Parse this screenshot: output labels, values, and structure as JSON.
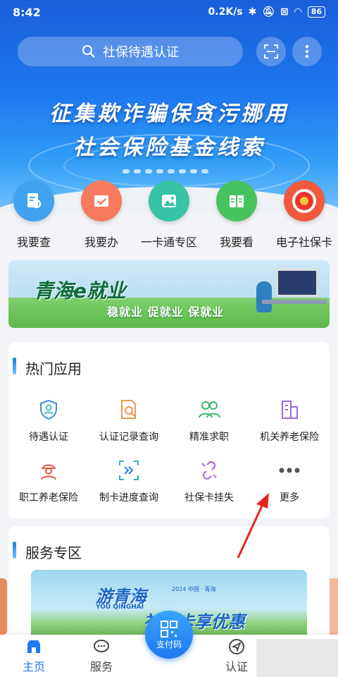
{
  "status": {
    "time": "8:42",
    "net_speed": "0.2K/s",
    "battery": "86"
  },
  "search": {
    "placeholder": "社保待遇认证"
  },
  "hero": {
    "line1": "征集欺诈骗保贪污挪用",
    "line2": "社会保险基金线索"
  },
  "quick": [
    {
      "label": "我要查",
      "icon": "search-doc-icon",
      "color": "#3fa3f0"
    },
    {
      "label": "我要办",
      "icon": "calendar-check-icon",
      "color": "#f77a5c"
    },
    {
      "label": "一卡通专区",
      "icon": "image-card-icon",
      "color": "#36c3a6"
    },
    {
      "label": "我要看",
      "icon": "book-icon",
      "color": "#48c25e"
    },
    {
      "label": "电子社保卡",
      "icon": "emblem-icon",
      "color": "#f05a3a"
    }
  ],
  "banner2": {
    "title": "青海e就业",
    "subtitle": "稳就业 促就业 保就业"
  },
  "hot": {
    "title": "热门应用",
    "apps": [
      {
        "label": "待遇认证",
        "icon": "shield-person-icon"
      },
      {
        "label": "认证记录查询",
        "icon": "doc-search-icon"
      },
      {
        "label": "精准求职",
        "icon": "people-icon"
      },
      {
        "label": "机关养老保险",
        "icon": "building-icon"
      },
      {
        "label": "职工养老保险",
        "icon": "worker-icon"
      },
      {
        "label": "制卡进度查询",
        "icon": "scan-progress-icon"
      },
      {
        "label": "社保卡挂失",
        "icon": "broken-link-icon"
      },
      {
        "label": "更多",
        "icon": "more-dots-icon"
      }
    ]
  },
  "service": {
    "title": "服务专区",
    "banner_title": "游青海",
    "banner_en": "YOU QINGHAI",
    "banner_mini": "2024 中国 · 青海",
    "banner_sub": "社保卡享优惠"
  },
  "tabs": [
    {
      "label": "主页",
      "icon": "home-icon"
    },
    {
      "label": "服务",
      "icon": "chat-icon"
    },
    {
      "label": "认证",
      "icon": "navigate-icon"
    }
  ],
  "pay": {
    "label": "支付码"
  },
  "colors": {
    "primary": "#1f78ee",
    "arrow": "#e8241f"
  }
}
